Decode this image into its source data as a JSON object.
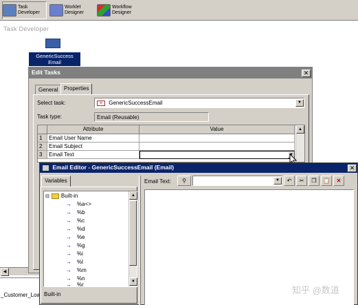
{
  "toolbar": {
    "task_developer": "Task\nDeveloper",
    "worklet_designer": "Worklet\nDesigner",
    "workflow_designer": "Workflow\nDesigner"
  },
  "workspace": {
    "title": "Task Developer",
    "task_label": "GenericSuccess\nEmail",
    "bottom_left_label": "_Customer_Loa"
  },
  "edit_tasks": {
    "title": "Edit Tasks",
    "tabs": [
      "General",
      "Properties"
    ],
    "select_task_label": "Select task:",
    "select_task_value": "GenericSuccessEmail",
    "task_type_label": "Task type:",
    "task_type_value": "Email (Reusable)",
    "grid": {
      "headers": [
        "Attribute",
        "Value"
      ],
      "rows": [
        {
          "num": "1",
          "attr": "Email User Name",
          "value": ""
        },
        {
          "num": "2",
          "attr": "Email Subject",
          "value": ""
        },
        {
          "num": "3",
          "attr": "Email Text",
          "value": ""
        }
      ]
    }
  },
  "email_editor": {
    "title": "Email Editor - GenericSuccessEmail (Email)",
    "variables_tab": "Variables",
    "email_text_label": "Email Text:",
    "tree_root": "Built-in",
    "tree_items": [
      "%a<>",
      "%b",
      "%c",
      "%d",
      "%e",
      "%g",
      "%i",
      "%l",
      "%m",
      "%n",
      "%r"
    ],
    "bottom_tab": "Built-in"
  },
  "watermark": "知乎 @数道"
}
